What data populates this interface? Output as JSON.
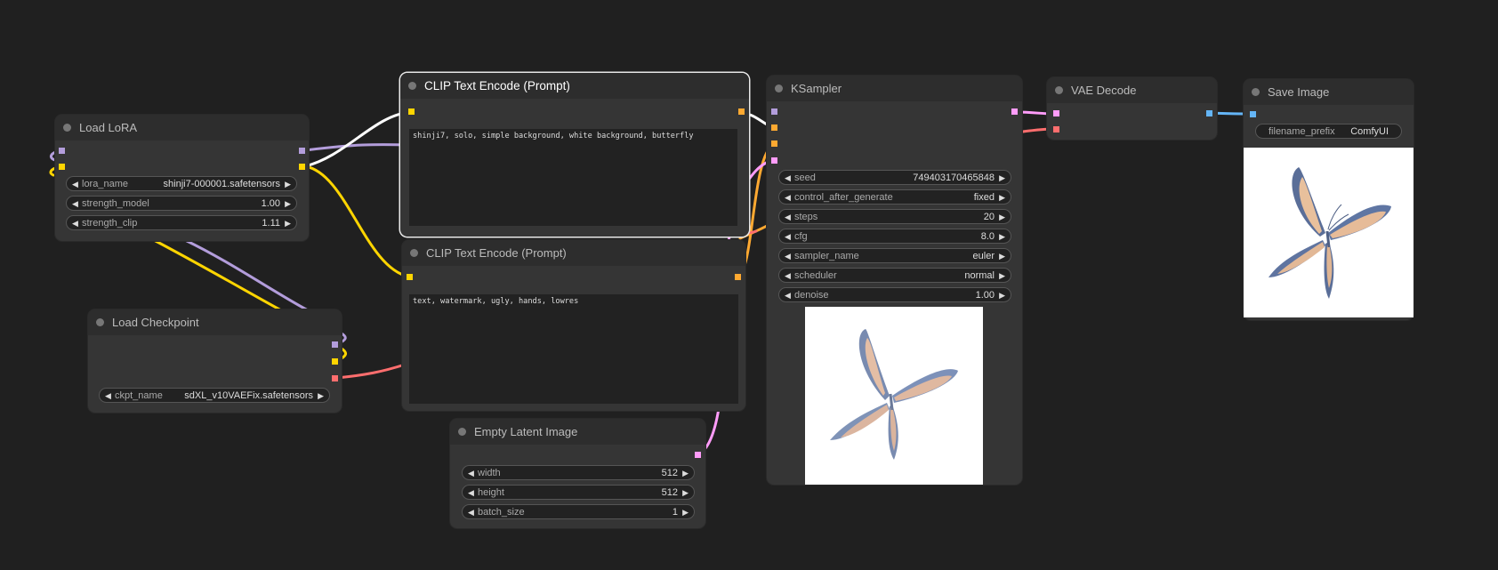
{
  "colors": {
    "clip": "#ffd500",
    "model": "#b39ddb",
    "vae": "#ff6e6e",
    "latent": "#ff9cf9",
    "image": "#64b5f6",
    "conditioning": "#ffa931",
    "selected_wire": "#ffffff"
  },
  "nodes": {
    "load_lora": {
      "title": "Load LoRA",
      "widgets": [
        {
          "label": "lora_name",
          "value": "shinji7-000001.safetensors"
        },
        {
          "label": "strength_model",
          "value": "1.00"
        },
        {
          "label": "strength_clip",
          "value": "1.11"
        }
      ]
    },
    "load_checkpoint": {
      "title": "Load Checkpoint",
      "widgets": [
        {
          "label": "ckpt_name",
          "value": "sdXL_v10VAEFix.safetensors"
        }
      ]
    },
    "clip_pos": {
      "title": "CLIP Text Encode (Prompt)",
      "text": "shinji7, solo, simple background, white background, butterfly"
    },
    "clip_neg": {
      "title": "CLIP Text Encode (Prompt)",
      "text": "text, watermark, ugly, hands, lowres"
    },
    "empty_latent": {
      "title": "Empty Latent Image",
      "widgets": [
        {
          "label": "width",
          "value": "512"
        },
        {
          "label": "height",
          "value": "512"
        },
        {
          "label": "batch_size",
          "value": "1"
        }
      ]
    },
    "ksampler": {
      "title": "KSampler",
      "widgets": [
        {
          "label": "seed",
          "value": "749403170465848"
        },
        {
          "label": "control_after_generate",
          "value": "fixed"
        },
        {
          "label": "steps",
          "value": "20"
        },
        {
          "label": "cfg",
          "value": "8.0"
        },
        {
          "label": "sampler_name",
          "value": "euler"
        },
        {
          "label": "scheduler",
          "value": "normal"
        },
        {
          "label": "denoise",
          "value": "1.00"
        }
      ]
    },
    "vae_decode": {
      "title": "VAE Decode"
    },
    "save_image": {
      "title": "Save Image",
      "widgets": [
        {
          "label": "filename_prefix",
          "value": "ComfyUI"
        }
      ]
    }
  }
}
